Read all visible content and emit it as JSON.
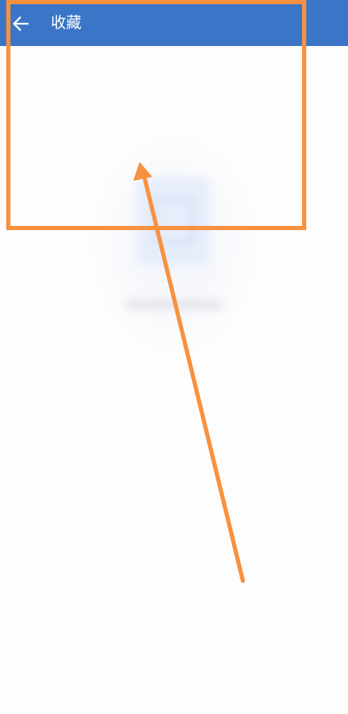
{
  "app_bar": {
    "back_icon": "arrow-left-icon",
    "title": "收藏",
    "background_color": "#3a75c7",
    "foreground_color": "#ffffff"
  },
  "empty_state": {
    "icon": "empty-document-icon",
    "icon_color": "#e7eefb"
  },
  "annotation": {
    "highlight_color": "#f8913f",
    "arrow_color": "#f8913f"
  }
}
